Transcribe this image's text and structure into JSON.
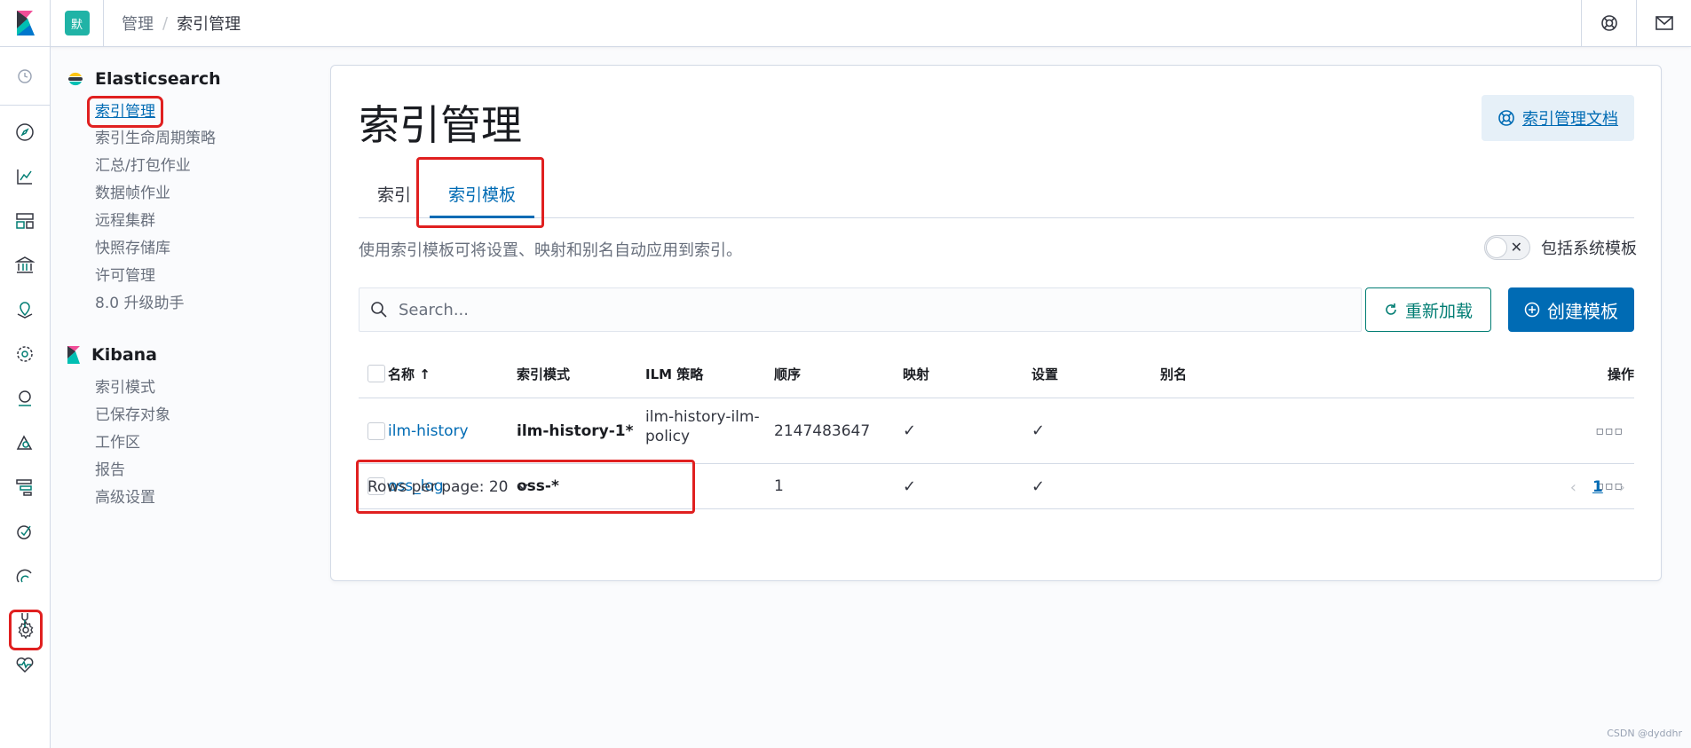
{
  "header": {
    "space_initial": "默",
    "breadcrumbs": [
      "管理",
      "索引管理"
    ]
  },
  "sidebar": {
    "sections": [
      {
        "title": "Elasticsearch",
        "items": [
          "索引管理",
          "索引生命周期策略",
          "汇总/打包作业",
          "数据帧作业",
          "远程集群",
          "快照存储库",
          "许可管理",
          "8.0 升级助手"
        ]
      },
      {
        "title": "Kibana",
        "items": [
          "索引模式",
          "已保存对象",
          "工作区",
          "报告",
          "高级设置"
        ]
      }
    ]
  },
  "main": {
    "title": "索引管理",
    "doc_link": "索引管理文档",
    "tabs": [
      "索引",
      "索引模板"
    ],
    "description": "使用索引模板可将设置、映射和别名自动应用到索引。",
    "toggle_label": "包括系统模板",
    "search_placeholder": "Search...",
    "reload_label": "重新加载",
    "create_label": "创建模板"
  },
  "table": {
    "columns": [
      "名称",
      "索引模式",
      "ILM 策略",
      "顺序",
      "映射",
      "设置",
      "别名",
      "操作"
    ],
    "sort_indicator": "↑",
    "rows": [
      {
        "name": "ilm-history",
        "pattern": "ilm-history-1*",
        "ilm_policy_line1": "ilm-history-ilm-",
        "ilm_policy_line2": "policy",
        "order": "2147483647",
        "mappings": "✓",
        "settings": "✓",
        "aliases": "",
        "actions": "▫▫▫"
      },
      {
        "name": "oss_log",
        "pattern": "oss-*",
        "ilm_policy_line1": "",
        "ilm_policy_line2": "",
        "order": "1",
        "mappings": "✓",
        "settings": "✓",
        "aliases": "",
        "actions": "▫▫▫"
      }
    ]
  },
  "pagination": {
    "rows_per_page": "Rows per page: 20",
    "current_page": "1"
  },
  "watermark": "CSDN @dyddhr",
  "colors": {
    "accent": "#006bb4",
    "secondary": "#017d73",
    "highlight": "#e02020"
  }
}
